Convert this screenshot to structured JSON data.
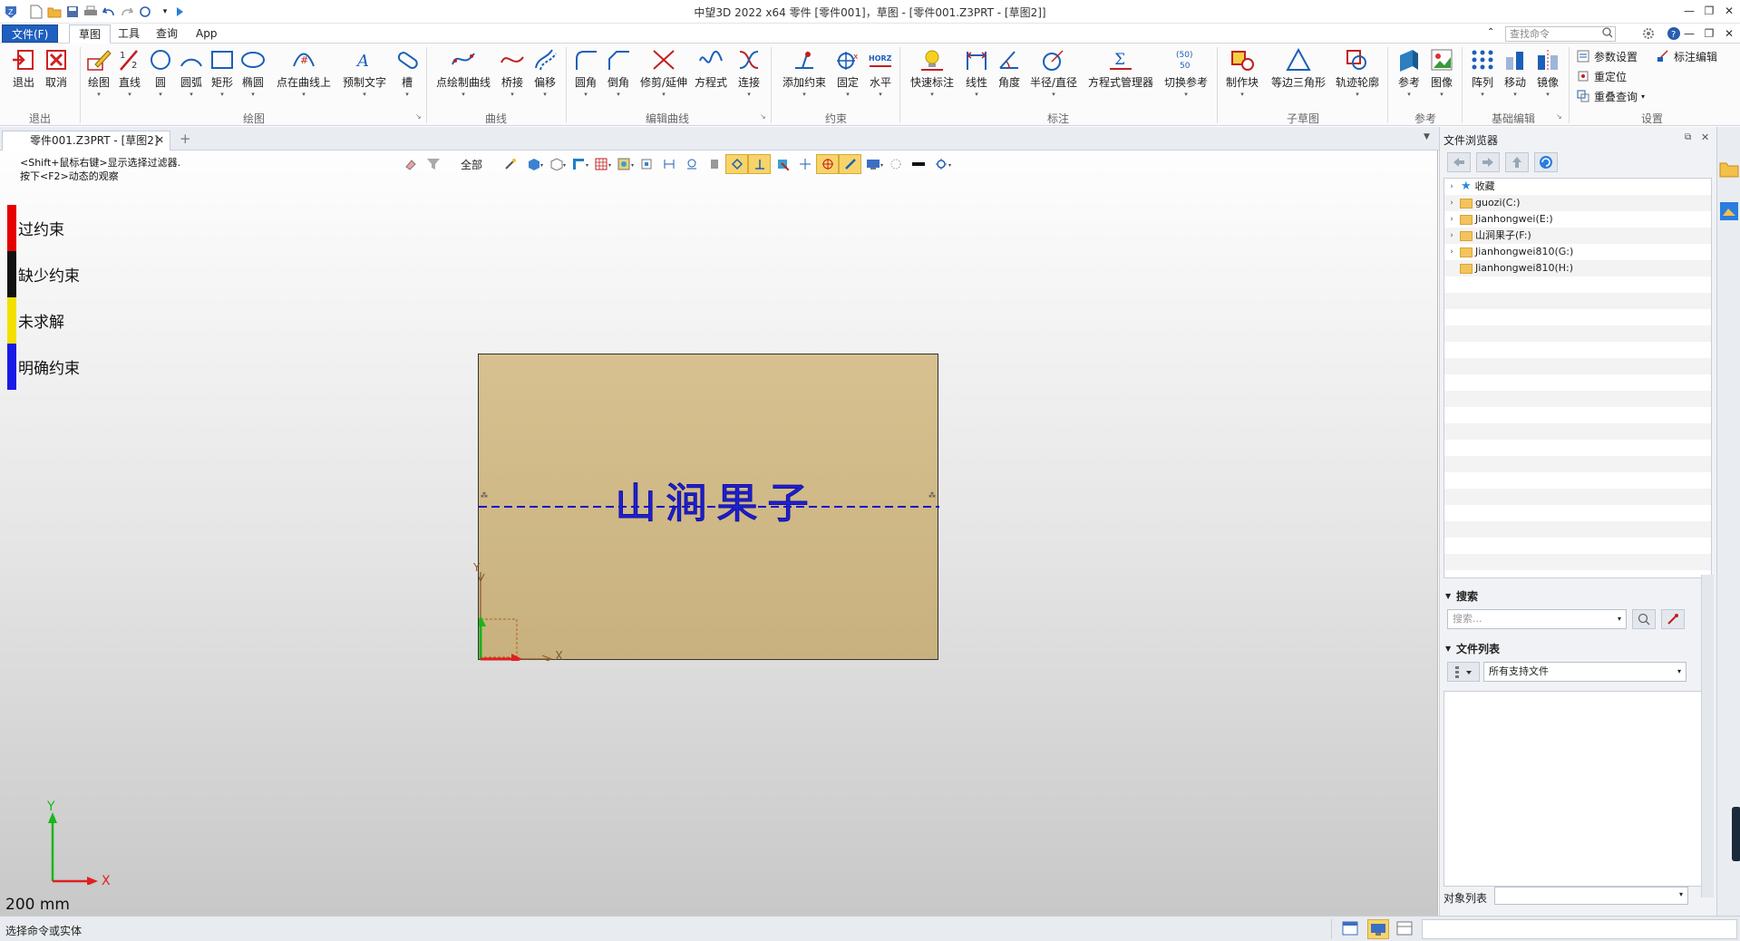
{
  "titlebar": {
    "title": "中望3D 2022 x64      零件 [零件001]，草图 - [零件001.Z3PRT - [草图2]]"
  },
  "menu": {
    "tabs": [
      "文件(F)",
      "草图",
      "工具",
      "查询",
      "App"
    ],
    "search_placeholder": "查找命令"
  },
  "ribbon": {
    "groups": [
      {
        "label": "退出",
        "buttons": [
          "退出",
          "取消"
        ]
      },
      {
        "label": "绘图",
        "buttons": [
          "绘图",
          "直线",
          "圆",
          "圆弧",
          "矩形",
          "椭圆",
          "点在曲线上",
          "预制文字",
          "槽"
        ]
      },
      {
        "label": "曲线",
        "buttons": [
          "点绘制曲线",
          "桥接",
          "偏移"
        ]
      },
      {
        "label": "编辑曲线",
        "buttons": [
          "圆角",
          "倒角",
          "修剪/延伸",
          "方程式",
          "连接"
        ]
      },
      {
        "label": "约束",
        "buttons": [
          "添加约束",
          "固定",
          "水平"
        ]
      },
      {
        "label": "标注",
        "buttons": [
          "快速标注",
          "线性",
          "角度",
          "半径/直径",
          "方程式管理器",
          "切换参考"
        ]
      },
      {
        "label": "子草图",
        "buttons": [
          "制作块",
          "等边三角形",
          "轨迹轮廓"
        ]
      },
      {
        "label": "参考",
        "buttons": [
          "参考",
          "图像"
        ]
      },
      {
        "label": "基础编辑",
        "buttons": [
          "阵列",
          "移动",
          "镜像"
        ]
      },
      {
        "label": "设置",
        "small": [
          "参数设置",
          "标注编辑",
          "重定位",
          "重叠查询"
        ]
      }
    ],
    "horz_text": "HORZ",
    "equation_text": "Σ",
    "switch_ref_text": "(50)\n50"
  },
  "document": {
    "tab_label": "零件001.Z3PRT - [草图2]"
  },
  "viewport": {
    "hint_line1": "<Shift+鼠标右键>显示选择过滤器.",
    "hint_line2": "按下<F2>动态的观察",
    "filter_label": "全部",
    "legend": [
      {
        "label": "过约束",
        "color": "#e60000"
      },
      {
        "label": "缺少约束",
        "color": "#111111"
      },
      {
        "label": "未求解",
        "color": "#f3e000"
      },
      {
        "label": "明确约束",
        "color": "#1a1ae6"
      }
    ],
    "sketch_text": "山涧果子",
    "axis_x": "X",
    "axis_y": "Y",
    "scale": "200 mm"
  },
  "panel": {
    "title": "文件浏览器",
    "tree": [
      {
        "label": "收藏",
        "star": true
      },
      {
        "label": "guozi(C:)"
      },
      {
        "label": "Jianhongwei(E:)"
      },
      {
        "label": "山涧果子(F:)"
      },
      {
        "label": "Jianhongwei810(G:)"
      },
      {
        "label": "Jianhongwei810(H:)"
      }
    ],
    "search_header": "搜索",
    "search_placeholder": "搜索...",
    "filelist_header": "文件列表",
    "filter_value": "所有支持文件",
    "object_list_label": "对象列表"
  },
  "status": {
    "text": "选择命令或实体"
  },
  "colors": {
    "accent": "#1f5fbf",
    "sketch_fill": "#d2bb88",
    "sketch_line": "#1414c8"
  }
}
